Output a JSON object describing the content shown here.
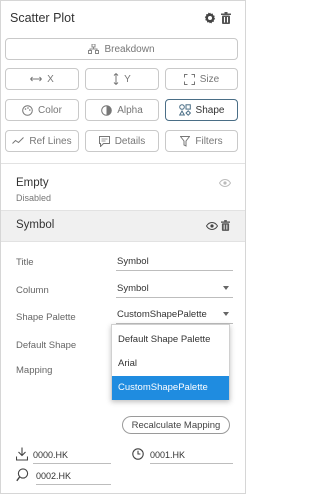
{
  "header": {
    "title": "Scatter Plot",
    "settings_icon": "gear-icon",
    "delete_icon": "trash-icon"
  },
  "toolbar": {
    "breakdown": "Breakdown",
    "x": "X",
    "y": "Y",
    "size": "Size",
    "color": "Color",
    "alpha": "Alpha",
    "shape": "Shape",
    "ref_lines": "Ref Lines",
    "details": "Details",
    "filters": "Filters",
    "active": "Shape"
  },
  "items": [
    {
      "name": "Empty",
      "status": "Disabled"
    },
    {
      "name": "Symbol"
    }
  ],
  "form": {
    "title_label": "Title",
    "title_value": "Symbol",
    "column_label": "Column",
    "column_value": "Symbol",
    "palette_label": "Shape Palette",
    "palette_value": "CustomShapePalette",
    "default_shape_label": "Default Shape",
    "mapping_label": "Mapping"
  },
  "dropdown": {
    "options": [
      "Default Shape Palette",
      "Arial",
      "CustomShapePalette"
    ],
    "selected": "CustomShapePalette"
  },
  "recalculate_label": "Recalculate Mapping",
  "mappings": [
    {
      "value": "0000.HK",
      "icon": "download-arrow-icon"
    },
    {
      "value": "0001.HK",
      "icon": "clock-icon"
    },
    {
      "value": "0002.HK",
      "icon": "magnifier-icon"
    }
  ],
  "colors": {
    "accent": "#1f8ce0",
    "active_border": "#4a6e86"
  }
}
